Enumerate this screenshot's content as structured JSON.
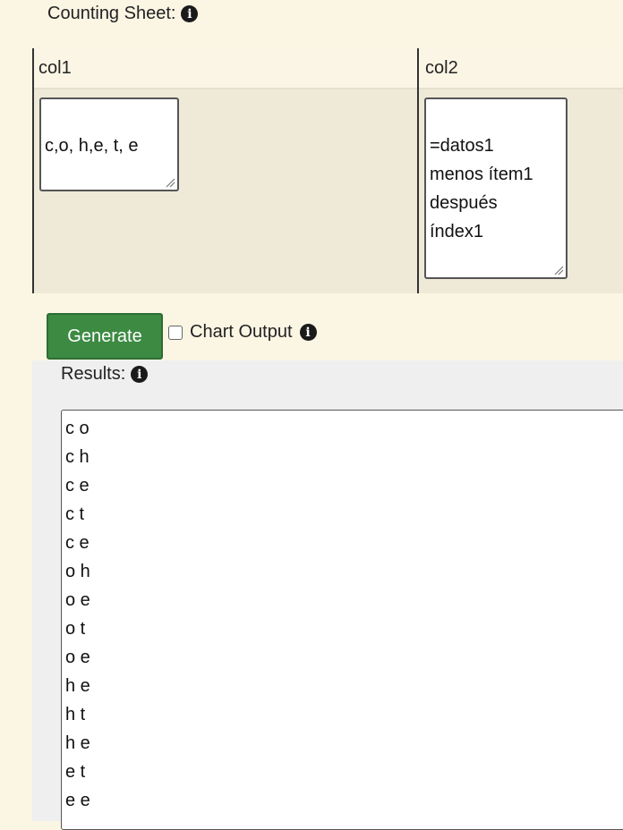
{
  "sheet": {
    "title": "Counting Sheet:",
    "columns": [
      {
        "header": "col1",
        "value": "c,o, h,e, t, e"
      },
      {
        "header": "col2",
        "value": "=datos1\nmenos ítem1\ndespués\níndex1"
      }
    ]
  },
  "controls": {
    "generate_label": "Generate",
    "chart_output_label": "Chart Output",
    "chart_output_checked": false
  },
  "results": {
    "title": "Results:",
    "lines": [
      "c o",
      "c h",
      "c e",
      "c t",
      "c e",
      "o h",
      "o e",
      "o t",
      "o e",
      "h e",
      "h t",
      "h e",
      "e t",
      "e e"
    ]
  },
  "colors": {
    "page_background": "#fbf5e3",
    "generate_button": "#3d8a43",
    "results_panel": "#efefef"
  }
}
